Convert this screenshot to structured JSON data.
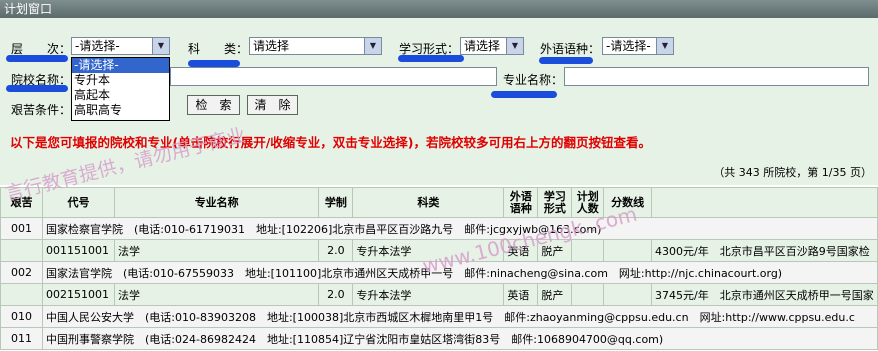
{
  "window": {
    "title": "计划窗口"
  },
  "filters": {
    "level": {
      "label": "层　　次：",
      "value": "-请选择-"
    },
    "subject": {
      "label": "科　　类：",
      "value": "请选择"
    },
    "study_mode": {
      "label": "学习形式：",
      "value": "请选择"
    },
    "language": {
      "label": "外语语种：",
      "value": "-请选择-"
    },
    "school_name": {
      "label": "院校名称：",
      "value": ""
    },
    "major_name": {
      "label": "专业名称：",
      "value": ""
    },
    "hardship": {
      "label": "艰苦条件："
    },
    "search_button": "检　索",
    "clear_button": "清　除",
    "level_options": [
      "-请选择-",
      "专升本",
      "高起本",
      "高职高专"
    ]
  },
  "notice": "以下是您可填报的院校和专业(单击院校行展开/收缩专业，双击专业选择)，若院校较多可用右上方的翻页按钮查看。",
  "pagination": {
    "text": "（共 343 所院校，第 1/35 页）"
  },
  "watermark": {
    "line1": "言行教育提供，请勿用于商业",
    "line2": "www.100chengk..com"
  },
  "table": {
    "headers": [
      "艰苦",
      "代号",
      "专业名称",
      "学制",
      "科类",
      "外语语种",
      "学习形式",
      "计划人数",
      "分数线",
      ""
    ],
    "rows": [
      {
        "type": "school",
        "code": "001",
        "text": "国家检察官学院　(电话:010-61719031　地址:[102206]北京市昌平区百沙路九号　邮件:jcgxyjwb@163.com)"
      },
      {
        "type": "major",
        "code": "001151001",
        "name": "法学",
        "years": "2.0",
        "category": "专升本法学",
        "lang": "英语",
        "mode": "脱产",
        "plan": "",
        "score": "",
        "extra": "4300元/年　北京市昌平区百沙路9号国家检"
      },
      {
        "type": "school",
        "code": "002",
        "text": "国家法官学院　(电话:010-67559033　地址:[101100]北京市通州区天成桥甲一号　邮件:ninacheng@sina.com　网址:http://njc.chinacourt.org)"
      },
      {
        "type": "major",
        "code": "002151001",
        "name": "法学",
        "years": "2.0",
        "category": "专升本法学",
        "lang": "英语",
        "mode": "脱产",
        "plan": "",
        "score": "",
        "extra": "3745元/年　北京市通州区天成桥甲一号国家"
      },
      {
        "type": "school",
        "code": "010",
        "text": "中国人民公安大学　(电话:010-83903208　地址:[100038]北京市西城区木樨地南里甲1号　邮件:zhaoyanming@cppsu.edu.cn　网址:http://www.cppsu.edu.c"
      },
      {
        "type": "school",
        "code": "011",
        "text": "中国刑事警察学院　(电话:024-86982424　地址:[110854]辽宁省沈阳市皇姑区塔湾街83号　邮件:1068904700@qq.com)"
      }
    ]
  },
  "colors": {
    "panel_bg": "#e6f2e6",
    "notice": "#e00000",
    "marker": "#1a4ddb",
    "watermark": "#d7a0cc"
  }
}
